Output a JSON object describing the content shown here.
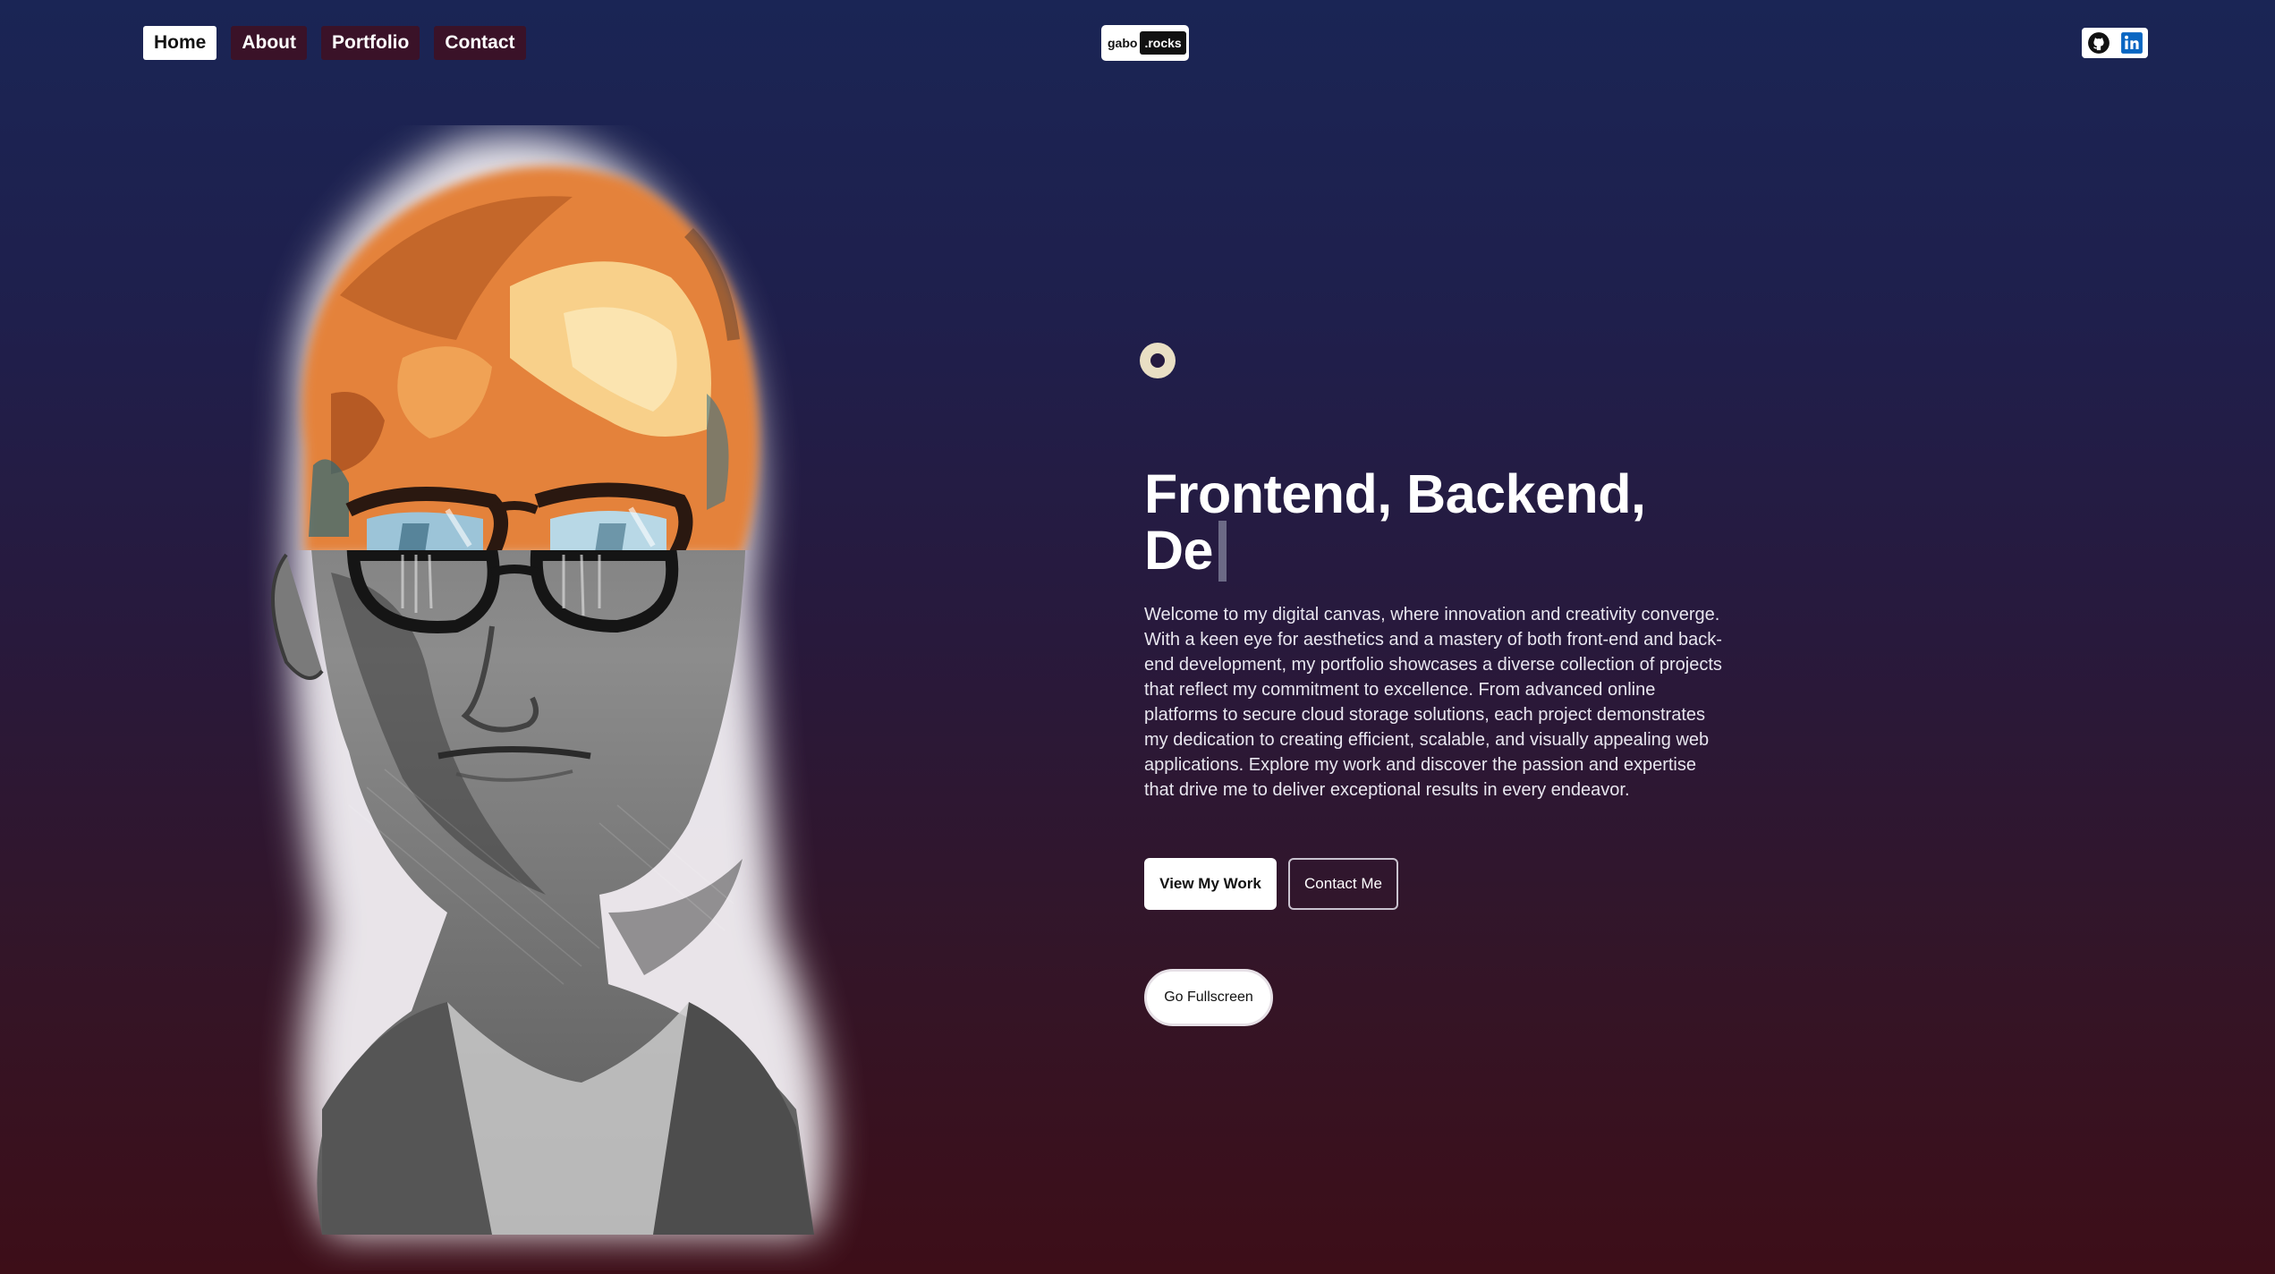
{
  "nav": {
    "items": [
      {
        "label": "Home",
        "active": true
      },
      {
        "label": "About",
        "active": false
      },
      {
        "label": "Portfolio",
        "active": false
      },
      {
        "label": "Contact",
        "active": false
      }
    ]
  },
  "logo": {
    "left": "gabo",
    "right": ".rocks"
  },
  "social": {
    "icons": [
      "github-icon",
      "linkedin-icon"
    ]
  },
  "hero": {
    "headline_line1": "Frontend, Backend,",
    "headline_line2": "De",
    "intro": "Welcome to my digital canvas, where innovation and creativity converge. With a keen eye for aesthetics and a mastery of both front-end and back-end development, my portfolio showcases a diverse collection of projects that reflect my commitment to excellence. From advanced online platforms to secure cloud storage solutions, each project demonstrates my dedication to creating efficient, scalable, and visually appealing web applications. Explore my work and discover the passion and expertise that drive me to deliver exceptional results in every endeavor.",
    "primary_button": "View My Work",
    "secondary_button": "Contact Me",
    "fullscreen_button": "Go Fullscreen"
  },
  "colors": {
    "bg_top": "#1a2555",
    "bg_bottom": "#3d0e18",
    "nav_chip": "#3a1228",
    "ring": "#e9dfc4",
    "hair_orange": "#e07a2e",
    "linkedin_blue": "#0a66c2"
  }
}
